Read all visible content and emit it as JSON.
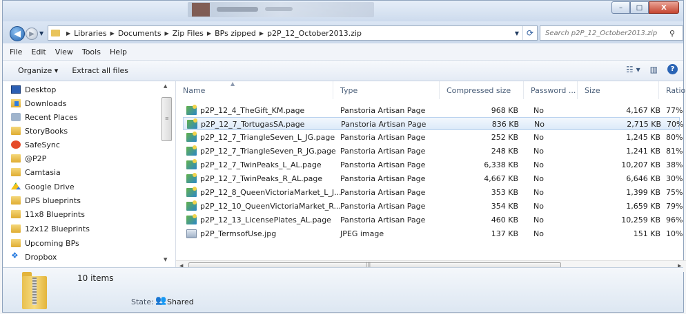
{
  "window": {
    "controls": {
      "minimize": "–",
      "maximize": "□",
      "close": "X"
    }
  },
  "address": {
    "crumbs": [
      "Libraries",
      "Documents",
      "Zip Files",
      "BPs zipped",
      "p2P_12_October2013.zip"
    ],
    "search_placeholder": "Search p2P_12_October2013.zip"
  },
  "menu": [
    "File",
    "Edit",
    "View",
    "Tools",
    "Help"
  ],
  "toolbar": {
    "organize": "Organize ▾",
    "extract": "Extract all files"
  },
  "nav": [
    {
      "label": "Desktop",
      "icon": "desktop-icon"
    },
    {
      "label": "Downloads",
      "icon": "downloads-icon"
    },
    {
      "label": "Recent Places",
      "icon": "recent-places-icon"
    },
    {
      "label": "StoryBooks",
      "icon": "folder-icon"
    },
    {
      "label": "SafeSync",
      "icon": "safesync-icon"
    },
    {
      "label": "@P2P",
      "icon": "folder-icon"
    },
    {
      "label": "Camtasia",
      "icon": "folder-icon"
    },
    {
      "label": "Google Drive",
      "icon": "google-drive-icon"
    },
    {
      "label": "DPS blueprints",
      "icon": "folder-icon"
    },
    {
      "label": "11x8 Blueprints",
      "icon": "folder-icon"
    },
    {
      "label": "12x12 Blueprints",
      "icon": "folder-icon"
    },
    {
      "label": "Upcoming BPs",
      "icon": "folder-icon"
    },
    {
      "label": "Dropbox",
      "icon": "dropbox-icon"
    }
  ],
  "columns": [
    "Name",
    "Type",
    "Compressed size",
    "Password ...",
    "Size",
    "Ratio"
  ],
  "files": [
    {
      "name": "p2P_12_4_TheGift_KM.page",
      "type": "Panstoria Artisan Page",
      "compressed": "968 KB",
      "password": "No",
      "size": "4,167 KB",
      "ratio": "77%"
    },
    {
      "name": "p2P_12_7_TortugasSA.page",
      "type": "Panstoria Artisan Page",
      "compressed": "836 KB",
      "password": "No",
      "size": "2,715 KB",
      "ratio": "70%"
    },
    {
      "name": "p2P_12_7_TriangleSeven_L_JG.page",
      "type": "Panstoria Artisan Page",
      "compressed": "252 KB",
      "password": "No",
      "size": "1,245 KB",
      "ratio": "80%"
    },
    {
      "name": "p2P_12_7_TriangleSeven_R_JG.page",
      "type": "Panstoria Artisan Page",
      "compressed": "248 KB",
      "password": "No",
      "size": "1,241 KB",
      "ratio": "81%"
    },
    {
      "name": "p2P_12_7_TwinPeaks_L_AL.page",
      "type": "Panstoria Artisan Page",
      "compressed": "6,338 KB",
      "password": "No",
      "size": "10,207 KB",
      "ratio": "38%"
    },
    {
      "name": "p2P_12_7_TwinPeaks_R_AL.page",
      "type": "Panstoria Artisan Page",
      "compressed": "4,667 KB",
      "password": "No",
      "size": "6,646 KB",
      "ratio": "30%"
    },
    {
      "name": "p2P_12_8_QueenVictoriaMarket_L_J...",
      "type": "Panstoria Artisan Page",
      "compressed": "353 KB",
      "password": "No",
      "size": "1,399 KB",
      "ratio": "75%"
    },
    {
      "name": "p2P_12_10_QueenVictoriaMarket_R...",
      "type": "Panstoria Artisan Page",
      "compressed": "354 KB",
      "password": "No",
      "size": "1,659 KB",
      "ratio": "79%"
    },
    {
      "name": "p2P_12_13_LicensePlates_AL.page",
      "type": "Panstoria Artisan Page",
      "compressed": "460 KB",
      "password": "No",
      "size": "10,259 KB",
      "ratio": "96%"
    },
    {
      "name": "p2P_TermsofUse.jpg",
      "type": "JPEG image",
      "compressed": "137 KB",
      "password": "No",
      "size": "151 KB",
      "ratio": "10%"
    }
  ],
  "details": {
    "count": "10 items",
    "state_label": "State:",
    "state_value": "Shared"
  }
}
